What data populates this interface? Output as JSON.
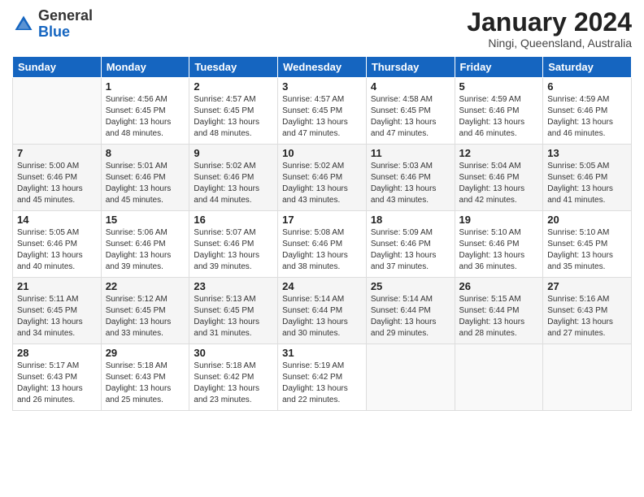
{
  "header": {
    "logo": {
      "general": "General",
      "blue": "Blue"
    },
    "month": "January 2024",
    "location": "Ningi, Queensland, Australia"
  },
  "weekdays": [
    "Sunday",
    "Monday",
    "Tuesday",
    "Wednesday",
    "Thursday",
    "Friday",
    "Saturday"
  ],
  "weeks": [
    [
      {
        "day": "",
        "sunrise": "",
        "sunset": "",
        "daylight": ""
      },
      {
        "day": "1",
        "sunrise": "Sunrise: 4:56 AM",
        "sunset": "Sunset: 6:45 PM",
        "daylight": "Daylight: 13 hours and 48 minutes."
      },
      {
        "day": "2",
        "sunrise": "Sunrise: 4:57 AM",
        "sunset": "Sunset: 6:45 PM",
        "daylight": "Daylight: 13 hours and 48 minutes."
      },
      {
        "day": "3",
        "sunrise": "Sunrise: 4:57 AM",
        "sunset": "Sunset: 6:45 PM",
        "daylight": "Daylight: 13 hours and 47 minutes."
      },
      {
        "day": "4",
        "sunrise": "Sunrise: 4:58 AM",
        "sunset": "Sunset: 6:45 PM",
        "daylight": "Daylight: 13 hours and 47 minutes."
      },
      {
        "day": "5",
        "sunrise": "Sunrise: 4:59 AM",
        "sunset": "Sunset: 6:46 PM",
        "daylight": "Daylight: 13 hours and 46 minutes."
      },
      {
        "day": "6",
        "sunrise": "Sunrise: 4:59 AM",
        "sunset": "Sunset: 6:46 PM",
        "daylight": "Daylight: 13 hours and 46 minutes."
      }
    ],
    [
      {
        "day": "7",
        "sunrise": "Sunrise: 5:00 AM",
        "sunset": "Sunset: 6:46 PM",
        "daylight": "Daylight: 13 hours and 45 minutes."
      },
      {
        "day": "8",
        "sunrise": "Sunrise: 5:01 AM",
        "sunset": "Sunset: 6:46 PM",
        "daylight": "Daylight: 13 hours and 45 minutes."
      },
      {
        "day": "9",
        "sunrise": "Sunrise: 5:02 AM",
        "sunset": "Sunset: 6:46 PM",
        "daylight": "Daylight: 13 hours and 44 minutes."
      },
      {
        "day": "10",
        "sunrise": "Sunrise: 5:02 AM",
        "sunset": "Sunset: 6:46 PM",
        "daylight": "Daylight: 13 hours and 43 minutes."
      },
      {
        "day": "11",
        "sunrise": "Sunrise: 5:03 AM",
        "sunset": "Sunset: 6:46 PM",
        "daylight": "Daylight: 13 hours and 43 minutes."
      },
      {
        "day": "12",
        "sunrise": "Sunrise: 5:04 AM",
        "sunset": "Sunset: 6:46 PM",
        "daylight": "Daylight: 13 hours and 42 minutes."
      },
      {
        "day": "13",
        "sunrise": "Sunrise: 5:05 AM",
        "sunset": "Sunset: 6:46 PM",
        "daylight": "Daylight: 13 hours and 41 minutes."
      }
    ],
    [
      {
        "day": "14",
        "sunrise": "Sunrise: 5:05 AM",
        "sunset": "Sunset: 6:46 PM",
        "daylight": "Daylight: 13 hours and 40 minutes."
      },
      {
        "day": "15",
        "sunrise": "Sunrise: 5:06 AM",
        "sunset": "Sunset: 6:46 PM",
        "daylight": "Daylight: 13 hours and 39 minutes."
      },
      {
        "day": "16",
        "sunrise": "Sunrise: 5:07 AM",
        "sunset": "Sunset: 6:46 PM",
        "daylight": "Daylight: 13 hours and 39 minutes."
      },
      {
        "day": "17",
        "sunrise": "Sunrise: 5:08 AM",
        "sunset": "Sunset: 6:46 PM",
        "daylight": "Daylight: 13 hours and 38 minutes."
      },
      {
        "day": "18",
        "sunrise": "Sunrise: 5:09 AM",
        "sunset": "Sunset: 6:46 PM",
        "daylight": "Daylight: 13 hours and 37 minutes."
      },
      {
        "day": "19",
        "sunrise": "Sunrise: 5:10 AM",
        "sunset": "Sunset: 6:46 PM",
        "daylight": "Daylight: 13 hours and 36 minutes."
      },
      {
        "day": "20",
        "sunrise": "Sunrise: 5:10 AM",
        "sunset": "Sunset: 6:45 PM",
        "daylight": "Daylight: 13 hours and 35 minutes."
      }
    ],
    [
      {
        "day": "21",
        "sunrise": "Sunrise: 5:11 AM",
        "sunset": "Sunset: 6:45 PM",
        "daylight": "Daylight: 13 hours and 34 minutes."
      },
      {
        "day": "22",
        "sunrise": "Sunrise: 5:12 AM",
        "sunset": "Sunset: 6:45 PM",
        "daylight": "Daylight: 13 hours and 33 minutes."
      },
      {
        "day": "23",
        "sunrise": "Sunrise: 5:13 AM",
        "sunset": "Sunset: 6:45 PM",
        "daylight": "Daylight: 13 hours and 31 minutes."
      },
      {
        "day": "24",
        "sunrise": "Sunrise: 5:14 AM",
        "sunset": "Sunset: 6:44 PM",
        "daylight": "Daylight: 13 hours and 30 minutes."
      },
      {
        "day": "25",
        "sunrise": "Sunrise: 5:14 AM",
        "sunset": "Sunset: 6:44 PM",
        "daylight": "Daylight: 13 hours and 29 minutes."
      },
      {
        "day": "26",
        "sunrise": "Sunrise: 5:15 AM",
        "sunset": "Sunset: 6:44 PM",
        "daylight": "Daylight: 13 hours and 28 minutes."
      },
      {
        "day": "27",
        "sunrise": "Sunrise: 5:16 AM",
        "sunset": "Sunset: 6:43 PM",
        "daylight": "Daylight: 13 hours and 27 minutes."
      }
    ],
    [
      {
        "day": "28",
        "sunrise": "Sunrise: 5:17 AM",
        "sunset": "Sunset: 6:43 PM",
        "daylight": "Daylight: 13 hours and 26 minutes."
      },
      {
        "day": "29",
        "sunrise": "Sunrise: 5:18 AM",
        "sunset": "Sunset: 6:43 PM",
        "daylight": "Daylight: 13 hours and 25 minutes."
      },
      {
        "day": "30",
        "sunrise": "Sunrise: 5:18 AM",
        "sunset": "Sunset: 6:42 PM",
        "daylight": "Daylight: 13 hours and 23 minutes."
      },
      {
        "day": "31",
        "sunrise": "Sunrise: 5:19 AM",
        "sunset": "Sunset: 6:42 PM",
        "daylight": "Daylight: 13 hours and 22 minutes."
      },
      {
        "day": "",
        "sunrise": "",
        "sunset": "",
        "daylight": ""
      },
      {
        "day": "",
        "sunrise": "",
        "sunset": "",
        "daylight": ""
      },
      {
        "day": "",
        "sunrise": "",
        "sunset": "",
        "daylight": ""
      }
    ]
  ]
}
